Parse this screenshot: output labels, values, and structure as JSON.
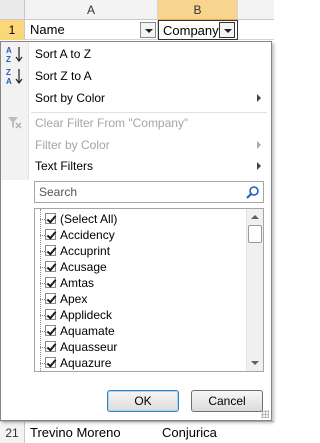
{
  "sheet": {
    "columns": [
      "A",
      "B"
    ],
    "row1": {
      "number": "1",
      "a": "Name",
      "b": "Company"
    },
    "row21": {
      "number": "21",
      "a": "Trevino Moreno",
      "b": "Conjurica"
    }
  },
  "menu": {
    "sort_az": "Sort A to Z",
    "sort_za": "Sort Z to A",
    "sort_color": "Sort by Color",
    "clear_filter": "Clear Filter From \"Company\"",
    "filter_color": "Filter by Color",
    "text_filters": "Text Filters",
    "icon_sort_az": "sort-ascending-icon",
    "icon_sort_za": "sort-descending-icon",
    "icon_clear": "clear-filter-icon"
  },
  "search": {
    "placeholder": "Search",
    "value": ""
  },
  "list": {
    "items": [
      {
        "label": "(Select All)",
        "checked": true
      },
      {
        "label": "Accidency",
        "checked": true
      },
      {
        "label": "Accuprint",
        "checked": true
      },
      {
        "label": "Acusage",
        "checked": true
      },
      {
        "label": "Amtas",
        "checked": true
      },
      {
        "label": "Apex",
        "checked": true
      },
      {
        "label": "Applideck",
        "checked": true
      },
      {
        "label": "Aquamate",
        "checked": true
      },
      {
        "label": "Aquasseur",
        "checked": true
      },
      {
        "label": "Aquazure",
        "checked": true
      }
    ]
  },
  "buttons": {
    "ok": "OK",
    "cancel": "Cancel"
  },
  "colors": {
    "selected_row": "#fbd779",
    "border": "#868686"
  }
}
